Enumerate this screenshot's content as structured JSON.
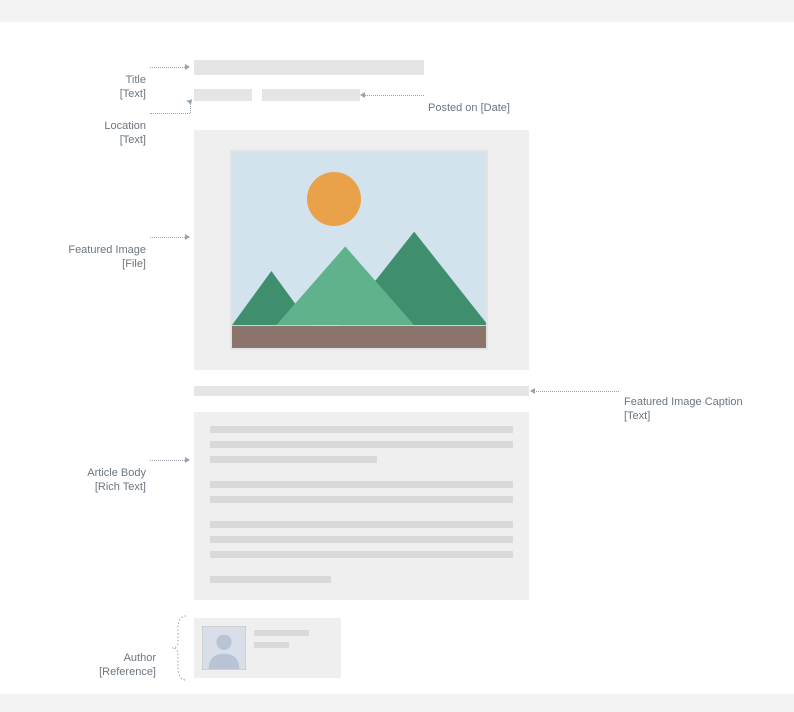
{
  "labels": {
    "title": "Title",
    "title_type": "[Text]",
    "location": "Location",
    "location_type": "[Text]",
    "posted_on": "Posted on [Date]",
    "featured_image": "Featured Image",
    "featured_image_type": "[File]",
    "featured_caption": "Featured Image Caption",
    "featured_caption_type": "[Text]",
    "article_body": "Article Body",
    "article_body_type": "[Rich Text]",
    "author": "Author",
    "author_type": "[Reference]"
  }
}
